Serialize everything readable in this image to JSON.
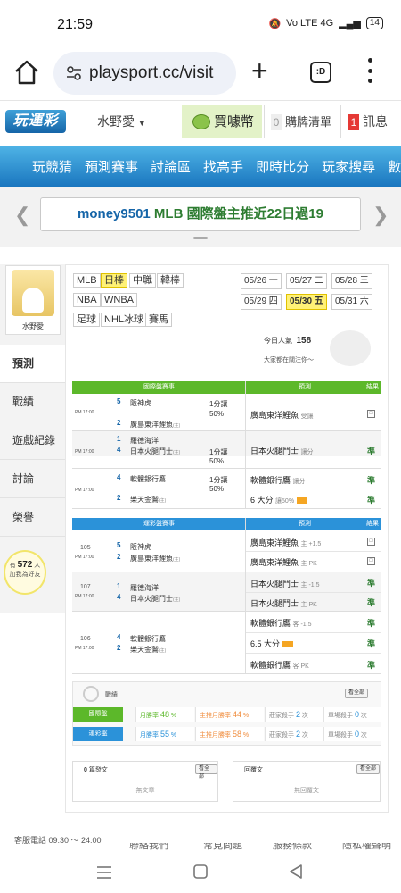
{
  "status_bar": {
    "time": "21:59",
    "indicators": "Vo LTE 4G",
    "battery": "14"
  },
  "browser": {
    "url": "playsport.cc/visit",
    "tab_count": ":D"
  },
  "site": {
    "logo": "玩運彩",
    "user_name": "水野愛",
    "buy_coin": "買噱幣",
    "cart_count": "0",
    "cart_label": "購牌清單",
    "msg_count": "1",
    "msg_label": "訊息"
  },
  "nav": [
    "玩競猜",
    "預測賽事",
    "討論區",
    "找高手",
    "即時比分",
    "玩家搜尋",
    "數據"
  ],
  "ticker": {
    "user": "money9501",
    "text": "MLB 國際盤主推近22日過19"
  },
  "sidebar": {
    "avatar_name": "水野愛",
    "items": [
      "預測",
      "戰績",
      "遊戲紀錄",
      "討論",
      "榮譽"
    ],
    "followers_pre": "有",
    "followers_count": "572",
    "followers_post": "人",
    "followers_sub": "加我為好友"
  },
  "league_chips": [
    "MLB",
    "日棒",
    "中職",
    "韓棒",
    "NBA",
    "WNBA",
    "足球",
    "NHL冰球",
    "賽馬"
  ],
  "selected_league": "日棒",
  "dates": [
    "05/26 一",
    "05/27 二",
    "05/28 三",
    "05/29 四",
    "05/30 五",
    "05/31 六"
  ],
  "selected_date": "05/30 五",
  "popularity": {
    "label": "今日人氣",
    "value": "158",
    "watching": "大家都在關注你～"
  },
  "intl_table": {
    "head_game": "國際盤賽事",
    "head_pred": "預測",
    "head_result": "結果",
    "rows": [
      {
        "time": "PM 17:00",
        "n1": "5",
        "t1": "阪神虎",
        "n2": "2",
        "t2": "廣島東洋鯉魚",
        "t2_mark": "(主)",
        "line": "1分讓",
        "pct": "50%",
        "pred": "廣島東洋鯉魚",
        "pred_note": "受讓",
        "result": "□"
      },
      {
        "time": "PM 17:00",
        "n1": "1",
        "t1": "羅德海洋",
        "n2": "4",
        "t2": "日本火腿鬥士",
        "t2_mark": "(主)",
        "line": "1分讓",
        "pct": "50%",
        "pred": "日本火腿鬥士",
        "pred_note": "讓分",
        "result": "準"
      },
      {
        "time": "PM 17:00",
        "n1": "4",
        "t1": "軟體銀行鷹",
        "n2": "2",
        "t2": "樂天金鷲",
        "t2_mark": "(主)",
        "line": "1分讓",
        "pct": "50%",
        "pred": "軟體銀行鷹",
        "pred_note": "讓分",
        "result": "準",
        "pred2": "6 大分",
        "pred2_note": "讓50%",
        "result2": "準"
      }
    ]
  },
  "local_table": {
    "head_game": "運彩盤賽事",
    "head_pred": "預測",
    "head_result": "結果",
    "rows": [
      {
        "id": "105",
        "time": "PM 17:00",
        "n1": "5",
        "t1": "阪神虎",
        "n2": "2",
        "t2": "廣島東洋鯉魚",
        "t2_mark": "(主)",
        "preds": [
          {
            "team": "廣島東洋鯉魚",
            "note": "主 +1.5",
            "result": "□"
          },
          {
            "team": "廣島東洋鯉魚",
            "note": "主 PK",
            "result": "□"
          }
        ]
      },
      {
        "id": "107",
        "time": "PM 17:00",
        "n1": "1",
        "t1": "羅德海洋",
        "n2": "4",
        "t2": "日本火腿鬥士",
        "t2_mark": "(主)",
        "preds": [
          {
            "team": "日本火腿鬥士",
            "note": "主 -1.5",
            "result": "準"
          },
          {
            "team": "日本火腿鬥士",
            "note": "主 PK",
            "result": "準"
          }
        ]
      },
      {
        "id": "106",
        "time": "PM 17:00",
        "n1": "4",
        "t1": "軟體銀行鷹",
        "n2": "2",
        "t2": "樂天金鷲",
        "t2_mark": "(主)",
        "preds": [
          {
            "team": "軟體銀行鷹",
            "note": "客 -1.5",
            "result": "準"
          },
          {
            "team": "6.5 大分",
            "note": "",
            "result": "準"
          },
          {
            "team": "軟體銀行鷹",
            "note": "客 PK",
            "result": "準"
          }
        ]
      }
    ]
  },
  "record": {
    "title": "戰績",
    "view_all": "看全部",
    "rows": [
      {
        "label": "國際盤",
        "month": "月勝率",
        "month_val": "48",
        "main": "主推月勝率",
        "main_val": "44",
        "rank": "莊家殺手",
        "rank_val": "2",
        "rank_unit": "次",
        "single": "單場殺手",
        "single_val": "0",
        "single_unit": "次"
      },
      {
        "label": "運彩盤",
        "month": "月勝率",
        "month_val": "55",
        "main": "主推月勝率",
        "main_val": "58",
        "rank": "莊家殺手",
        "rank_val": "2",
        "rank_unit": "次",
        "single": "單場殺手",
        "single_val": "0",
        "single_unit": "次"
      }
    ],
    "pct": "%"
  },
  "posts": {
    "left_count": "0",
    "left_label": "篇發文",
    "left_empty": "無文章",
    "left_btn": "看全部",
    "right_label": "回覆文",
    "right_empty": "無回覆文",
    "right_btn": "看全部"
  },
  "footer": {
    "service": "客服電話 09:30 ～ 24:00",
    "links": [
      "聯絡我們",
      "常見問題",
      "服務條款",
      "隱私權聲明"
    ]
  },
  "colors": {
    "green_head": "#5cb82a",
    "blue_head": "#2b92d9",
    "highlight": "#fff176",
    "nav_blue": "#1a76bf",
    "accent_green": "#2e7d32"
  }
}
